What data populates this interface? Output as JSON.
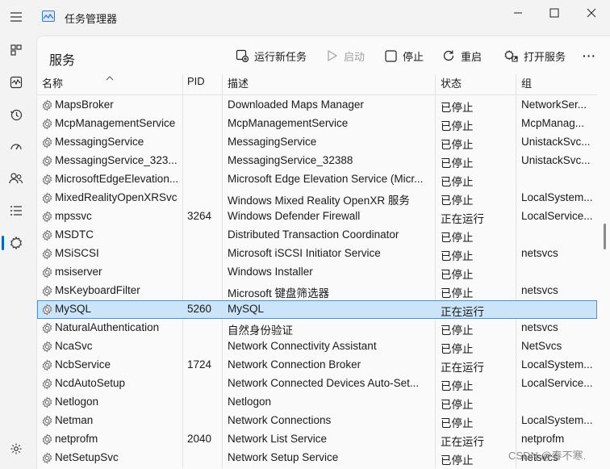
{
  "window": {
    "title": "任务管理器",
    "watermark": "CSDN @春不寒."
  },
  "panel": {
    "title": "服务"
  },
  "toolbar": {
    "new_task": "运行新任务",
    "start": "启动",
    "stop": "停止",
    "restart": "重启",
    "open_services": "打开服务",
    "more": "···"
  },
  "columns": {
    "name": "名称",
    "pid": "PID",
    "desc": "描述",
    "status": "状态",
    "group": "组"
  },
  "services": [
    {
      "name": "MapsBroker",
      "pid": "",
      "desc": "Downloaded Maps Manager",
      "status": "已停止",
      "group": "NetworkSer..."
    },
    {
      "name": "McpManagementService",
      "pid": "",
      "desc": "McpManagementService",
      "status": "已停止",
      "group": "McpManag..."
    },
    {
      "name": "MessagingService",
      "pid": "",
      "desc": "MessagingService",
      "status": "已停止",
      "group": "UnistackSvc..."
    },
    {
      "name": "MessagingService_323...",
      "pid": "",
      "desc": "MessagingService_32388",
      "status": "已停止",
      "group": "UnistackSvc..."
    },
    {
      "name": "MicrosoftEdgeElevation...",
      "pid": "",
      "desc": "Microsoft Edge Elevation Service (Micr...",
      "status": "已停止",
      "group": ""
    },
    {
      "name": "MixedRealityOpenXRSvc",
      "pid": "",
      "desc": "Windows Mixed Reality OpenXR 服务",
      "status": "已停止",
      "group": "LocalSystem..."
    },
    {
      "name": "mpssvc",
      "pid": "3264",
      "desc": "Windows Defender Firewall",
      "status": "正在运行",
      "group": "LocalService..."
    },
    {
      "name": "MSDTC",
      "pid": "",
      "desc": "Distributed Transaction Coordinator",
      "status": "已停止",
      "group": ""
    },
    {
      "name": "MSiSCSI",
      "pid": "",
      "desc": "Microsoft iSCSI Initiator Service",
      "status": "已停止",
      "group": "netsvcs"
    },
    {
      "name": "msiserver",
      "pid": "",
      "desc": "Windows Installer",
      "status": "已停止",
      "group": ""
    },
    {
      "name": "MsKeyboardFilter",
      "pid": "",
      "desc": "Microsoft 键盘筛选器",
      "status": "已停止",
      "group": "netsvcs"
    },
    {
      "name": "MySQL",
      "pid": "5260",
      "desc": "MySQL",
      "status": "正在运行",
      "group": "",
      "selected": true
    },
    {
      "name": "NaturalAuthentication",
      "pid": "",
      "desc": "自然身份验证",
      "status": "已停止",
      "group": "netsvcs"
    },
    {
      "name": "NcaSvc",
      "pid": "",
      "desc": "Network Connectivity Assistant",
      "status": "已停止",
      "group": "NetSvcs"
    },
    {
      "name": "NcbService",
      "pid": "1724",
      "desc": "Network Connection Broker",
      "status": "正在运行",
      "group": "LocalSystem..."
    },
    {
      "name": "NcdAutoSetup",
      "pid": "",
      "desc": "Network Connected Devices Auto-Set...",
      "status": "已停止",
      "group": "LocalService..."
    },
    {
      "name": "Netlogon",
      "pid": "",
      "desc": "Netlogon",
      "status": "已停止",
      "group": ""
    },
    {
      "name": "Netman",
      "pid": "",
      "desc": "Network Connections",
      "status": "已停止",
      "group": "LocalSystem..."
    },
    {
      "name": "netprofm",
      "pid": "2040",
      "desc": "Network List Service",
      "status": "正在运行",
      "group": "netprofm"
    },
    {
      "name": "NetSetupSvc",
      "pid": "",
      "desc": "Network Setup Service",
      "status": "已停止",
      "group": "netsvcs"
    }
  ],
  "colors": {
    "accent": "#0067c0",
    "selected_row": "#cce4f7"
  }
}
